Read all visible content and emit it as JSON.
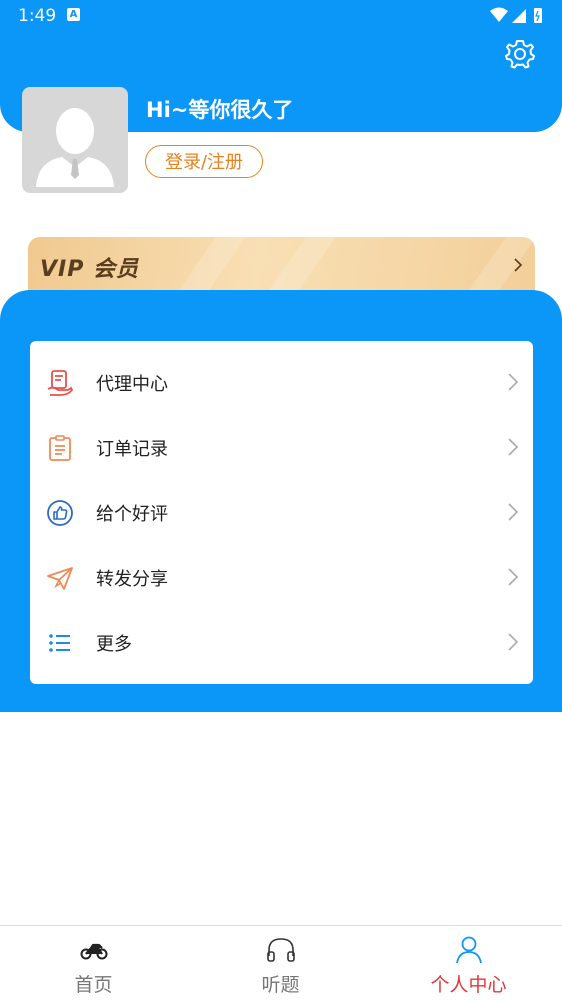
{
  "status_bar": {
    "time": "1:49",
    "notif_badge": "A"
  },
  "profile": {
    "greeting": "Hi~等你很久了",
    "login_label": "登录/注册"
  },
  "vip": {
    "label": "VIP 会员"
  },
  "menu": {
    "items": [
      {
        "label": "代理中心",
        "icon": "agent-icon",
        "color": "#e8504a"
      },
      {
        "label": "订单记录",
        "icon": "order-record-icon",
        "color": "#ef8a55"
      },
      {
        "label": "给个好评",
        "icon": "thumbs-up-icon",
        "color": "#2c6bc4"
      },
      {
        "label": "转发分享",
        "icon": "share-plane-icon",
        "color": "#ef8a55"
      },
      {
        "label": "更多",
        "icon": "list-icon",
        "color": "#1b8de6"
      }
    ]
  },
  "bottom_nav": {
    "items": [
      {
        "label": "首页",
        "icon": "motorcycle-icon"
      },
      {
        "label": "听题",
        "icon": "headphones-icon"
      },
      {
        "label": "个人中心",
        "icon": "person-icon",
        "active": true
      }
    ]
  },
  "colors": {
    "primary": "#0b97f7",
    "accent_orange": "#e8821f",
    "active_tab": "#e0373b"
  }
}
